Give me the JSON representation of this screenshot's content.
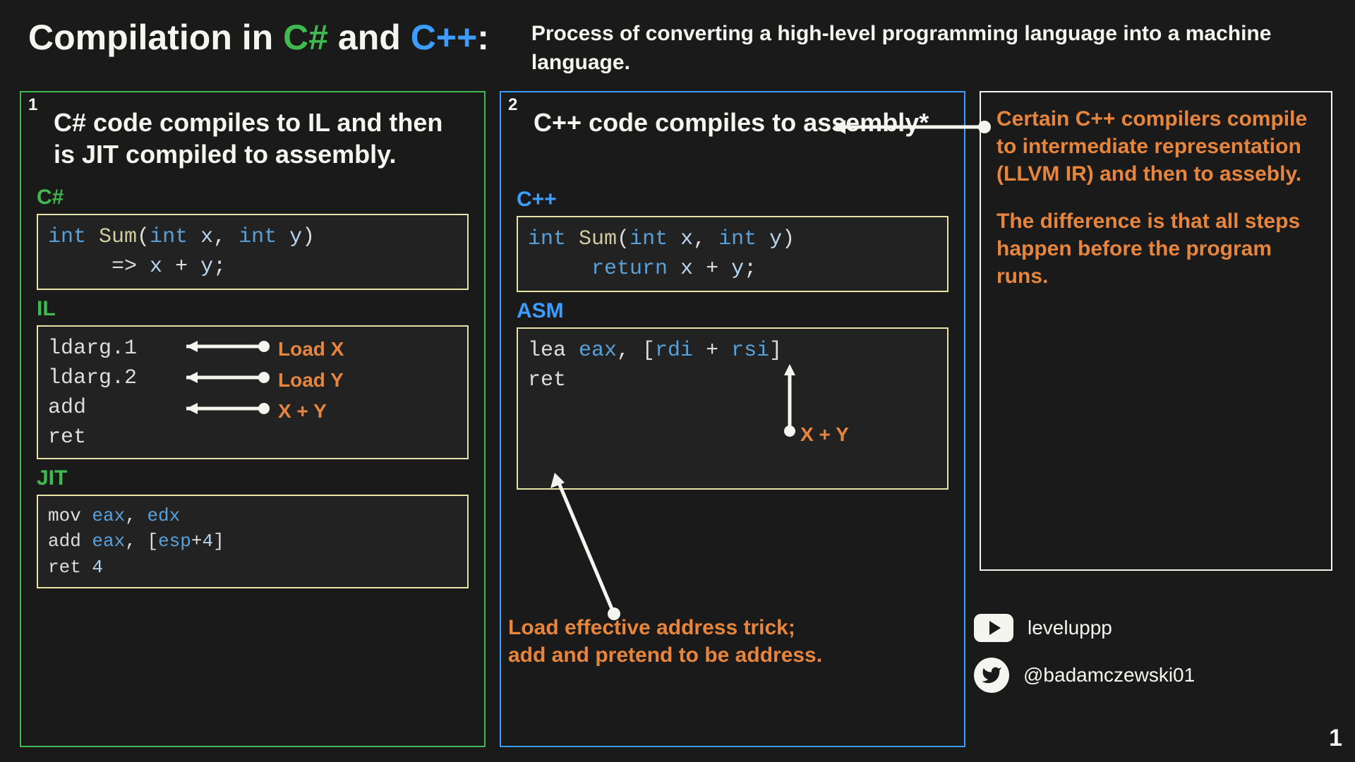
{
  "header": {
    "title_pre": "Compilation in ",
    "title_cs": "C#",
    "title_mid": " and ",
    "title_cpp": "C++",
    "title_post": ":",
    "subtitle": "Process of converting a high-level programming language into a machine language."
  },
  "panel_csharp": {
    "badge": "1",
    "title": "C# code compiles to IL and then is JIT compiled to assembly.",
    "labels": {
      "csharp": "C#",
      "il": "IL",
      "jit": "JIT"
    },
    "code_csharp": {
      "line1": {
        "kw_int": "int",
        "fn": "Sum",
        "paren_open": "(",
        "kw_int2": "int",
        "x": "x",
        "comma": ", ",
        "kw_int3": "int",
        "y": "y",
        "paren_close": ")"
      },
      "line2": {
        "arrow": "=> ",
        "x": "x",
        "plus": " + ",
        "y": "y",
        "semi": ";"
      }
    },
    "code_il": [
      "ldarg.1",
      "ldarg.2",
      "add",
      "ret"
    ],
    "il_notes": [
      "Load X",
      "Load Y",
      "X + Y"
    ],
    "code_jit": [
      {
        "op": "mov ",
        "r1": "eax",
        "c": ", ",
        "r2": "edx"
      },
      {
        "op": "add ",
        "r1": "eax",
        "c": ", [",
        "r2": "esp",
        "plus": "+",
        "lit": "4",
        "close": "]"
      },
      {
        "op": "ret ",
        "lit": "4"
      }
    ]
  },
  "panel_cpp": {
    "badge": "2",
    "title": "C++ code compiles to assembly*",
    "labels": {
      "cpp": "C++",
      "asm": "ASM"
    },
    "code_cpp": {
      "line1": {
        "kw_int": "int",
        "fn": "Sum",
        "paren_open": "(",
        "kw_int2": "int",
        "x": "x",
        "comma": ", ",
        "kw_int3": "int",
        "y": "y",
        "paren_close": ")"
      },
      "line2": {
        "kw_return": "return ",
        "x": "x",
        "plus": " + ",
        "y": "y",
        "semi": ";"
      }
    },
    "code_asm": [
      {
        "op": "lea ",
        "r1": "eax",
        "c": ", [",
        "r2": "rdi",
        "plus": " + ",
        "r3": "rsi",
        "close": "]"
      },
      {
        "op": "ret"
      }
    ],
    "asm_note": "X + Y",
    "lea_note": "Load effective address trick;\nadd and pretend to be address."
  },
  "panel_note": {
    "p1": "Certain C++ compilers compile to intermediate representation\n(LLVM IR) and then to assebly.",
    "p2": "The difference is that all steps happen before the program runs."
  },
  "socials": {
    "youtube": "leveluppp",
    "twitter": "@badamczewski01"
  },
  "page": "1"
}
